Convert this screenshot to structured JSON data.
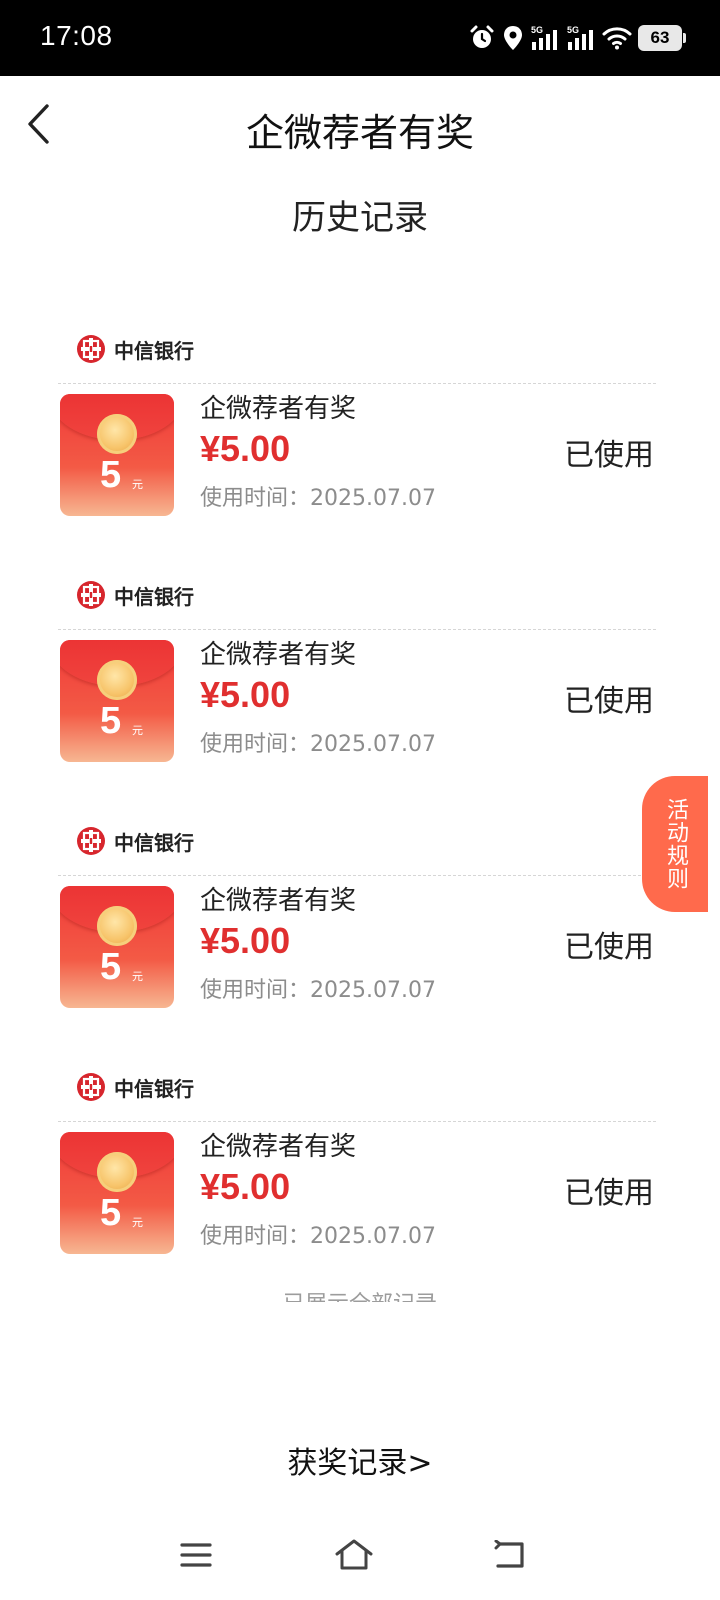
{
  "status_bar": {
    "time": "17:08",
    "battery": "63",
    "signal_label_1": "5G",
    "signal_label_2": "5G"
  },
  "header": {
    "title": "企微荐者有奖"
  },
  "section": {
    "title": "历史记录"
  },
  "records": [
    {
      "bank": "中信银行",
      "name": "企微荐者有奖",
      "amount": "¥5.00",
      "time": "使用时间：2025.07.07",
      "status": "已使用",
      "envelope_value": "5",
      "envelope_unit": "元"
    },
    {
      "bank": "中信银行",
      "name": "企微荐者有奖",
      "amount": "¥5.00",
      "time": "使用时间：2025.07.07",
      "status": "已使用",
      "envelope_value": "5",
      "envelope_unit": "元"
    },
    {
      "bank": "中信银行",
      "name": "企微荐者有奖",
      "amount": "¥5.00",
      "time": "使用时间：2025.07.07",
      "status": "已使用",
      "envelope_value": "5",
      "envelope_unit": "元"
    },
    {
      "bank": "中信银行",
      "name": "企微荐者有奖",
      "amount": "¥5.00",
      "time": "使用时间：2025.07.07",
      "status": "已使用",
      "envelope_value": "5",
      "envelope_unit": "元"
    }
  ],
  "end_note": "已展示全部记录",
  "rules_button": "活动规则",
  "awards_link": "获奖记录>",
  "icons": {
    "back": "chevron-left-icon",
    "alarm": "alarm-icon",
    "location": "location-icon",
    "signal": "signal-icon",
    "wifi": "wifi-icon",
    "menu": "menu-icon",
    "home": "home-icon",
    "back_nav": "return-icon",
    "bank_logo": "citic-logo-icon",
    "envelope": "red-envelope-icon"
  },
  "colors": {
    "accent_red": "#e02f2f",
    "rules_orange": "#ff6a4c"
  }
}
